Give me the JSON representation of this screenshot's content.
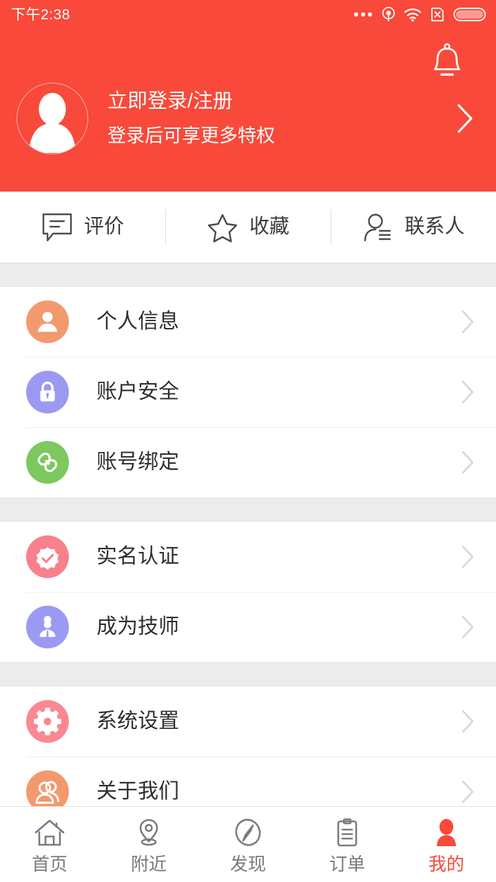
{
  "theme": {
    "brand_red": "#F8493A",
    "separator_grey": "#ECECEC",
    "text_dark": "#2e2e2e",
    "tab_inactive": "#7a7a7a"
  },
  "statusbar": {
    "time": "下午2:38",
    "icons": [
      "more-dots-icon",
      "location-radar-icon",
      "wifi-icon",
      "sim-card-disabled-icon",
      "battery-icon"
    ]
  },
  "header": {
    "bell_icon": "bell-icon",
    "avatar_icon": "avatar-placeholder-icon",
    "login_title": "立即登录/注册",
    "login_subtitle": "登录后可享更多特权",
    "chevron_icon": "chevron-right-icon"
  },
  "quick_actions": [
    {
      "label": "评价",
      "icon": "comment-icon"
    },
    {
      "label": "收藏",
      "icon": "star-icon"
    },
    {
      "label": "联系人",
      "icon": "contact-person-icon"
    }
  ],
  "menu_groups": [
    {
      "items": [
        {
          "label": "个人信息",
          "icon": "person-icon",
          "color": "#F3996E"
        },
        {
          "label": "账户安全",
          "icon": "lock-icon",
          "color": "#9A9AF2"
        },
        {
          "label": "账号绑定",
          "icon": "link-icon",
          "color": "#7DC85F"
        }
      ]
    },
    {
      "items": [
        {
          "label": "实名认证",
          "icon": "verified-badge-icon",
          "color": "#F9808D"
        },
        {
          "label": "成为技师",
          "icon": "technician-icon",
          "color": "#9A9AF2"
        }
      ]
    },
    {
      "items": [
        {
          "label": "系统设置",
          "icon": "gear-icon",
          "color": "#F98893"
        },
        {
          "label": "关于我们",
          "icon": "people-icon",
          "color": "#F3996E"
        }
      ]
    }
  ],
  "tabbar": {
    "items": [
      {
        "label": "首页",
        "icon": "home-icon",
        "active": false
      },
      {
        "label": "附近",
        "icon": "location-pin-icon",
        "active": false
      },
      {
        "label": "发现",
        "icon": "compass-icon",
        "active": false
      },
      {
        "label": "订单",
        "icon": "clipboard-icon",
        "active": false
      },
      {
        "label": "我的",
        "icon": "user-icon",
        "active": true
      }
    ]
  }
}
